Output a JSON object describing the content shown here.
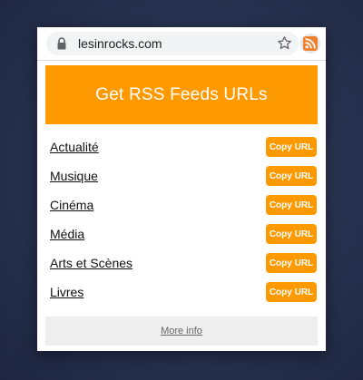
{
  "browser": {
    "url": "lesinrocks.com",
    "icons": {
      "lock": "lock-icon",
      "bookmark": "star-icon",
      "extension": "rss-icon"
    }
  },
  "popup": {
    "title": "Get RSS Feeds URLs",
    "feeds": [
      {
        "label": "Actualité",
        "button": "Copy URL"
      },
      {
        "label": "Musique",
        "button": "Copy URL"
      },
      {
        "label": "Cinéma",
        "button": "Copy URL"
      },
      {
        "label": "Média",
        "button": "Copy URL"
      },
      {
        "label": "Arts et Scènes",
        "button": "Copy URL"
      },
      {
        "label": "Livres",
        "button": "Copy URL"
      }
    ],
    "more_info": "More info"
  },
  "colors": {
    "accent": "#ff9900",
    "footer_bg": "#eeeeee",
    "backdrop": "#2a3452"
  }
}
